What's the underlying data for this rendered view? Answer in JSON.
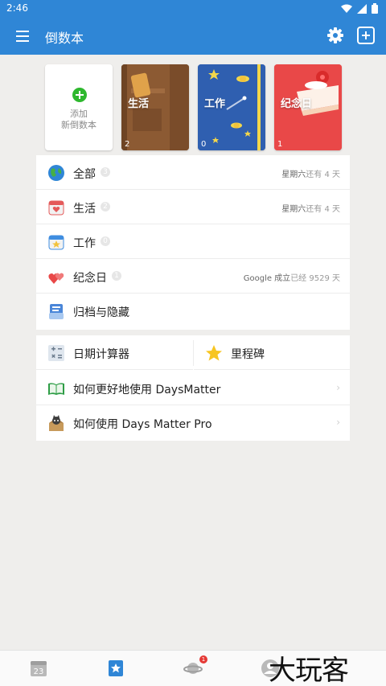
{
  "status_bar": {
    "time": "2:46"
  },
  "app_bar": {
    "title": "倒数本"
  },
  "books": [
    {
      "line1": "添加",
      "line2": "新倒数本"
    },
    {
      "label": "生活",
      "count": "2"
    },
    {
      "label": "工作",
      "count": "0"
    },
    {
      "label": "纪念日",
      "count": "1"
    }
  ],
  "list": [
    {
      "label": "全部",
      "badge": "3",
      "info_a": "星期六",
      "info_b": "还有 4 天"
    },
    {
      "label": "生活",
      "badge": "2",
      "info_a": "星期六",
      "info_b": "还有 4 天"
    },
    {
      "label": "工作",
      "badge": "0"
    },
    {
      "label": "纪念日",
      "badge": "1",
      "info_a": "Google 成立",
      "info_b": "已经 9529 天"
    },
    {
      "label": "归档与隐藏"
    }
  ],
  "tools": {
    "calculator": "日期计算器",
    "milestone": "里程碑",
    "howto": "如何更好地使用 DaysMatter",
    "pro": "如何使用 Days Matter Pro",
    "chevron": "›"
  },
  "bottom_nav": {
    "calendar_day": "23",
    "notification_count": "1"
  },
  "watermark": "大玩客",
  "colors": {
    "primary": "#2f86d6",
    "background": "#efeeec",
    "green": "#2eb82e",
    "red": "#e94848"
  }
}
